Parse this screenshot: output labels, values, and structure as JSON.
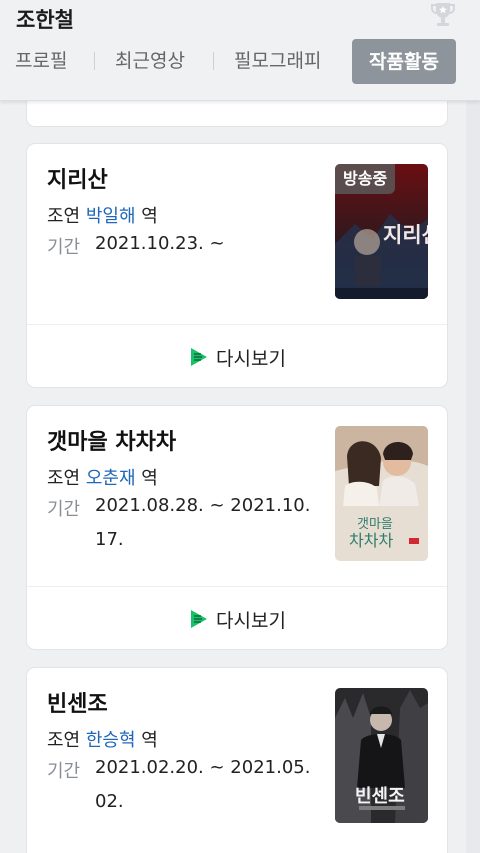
{
  "header": {
    "person_name": "조한철",
    "tabs": [
      {
        "label": "프로필"
      },
      {
        "label": "최근영상"
      },
      {
        "label": "필모그래피"
      },
      {
        "label": "작품활동",
        "active": true
      }
    ]
  },
  "icons": {
    "trophy": "trophy-icon",
    "replay": "play-replay-icon"
  },
  "colors": {
    "role_link": "#1f68b8",
    "active_tab_bg": "#8d949b",
    "replay_icon_green": "#19c26a"
  },
  "works": [
    {
      "title": "지리산",
      "role_prefix": "조연",
      "role_name": "박일해",
      "role_suffix": "역",
      "period_label": "기간",
      "period": "2021.10.23. ~",
      "badge": "방송중",
      "poster_icon": "jirisan-poster",
      "replay_label": "다시보기"
    },
    {
      "title": "갯마을 차차차",
      "role_prefix": "조연",
      "role_name": "오춘재",
      "role_suffix": "역",
      "period_label": "기간",
      "period": "2021.08.28. ~ 2021.10.17.",
      "poster_icon": "hometown-chachacha-poster",
      "replay_label": "다시보기"
    },
    {
      "title": "빈센조",
      "role_prefix": "조연",
      "role_name": "한승혁",
      "role_suffix": "역",
      "period_label": "기간",
      "period": "2021.02.20. ~ 2021.05.02.",
      "poster_icon": "vincenzo-poster"
    }
  ]
}
